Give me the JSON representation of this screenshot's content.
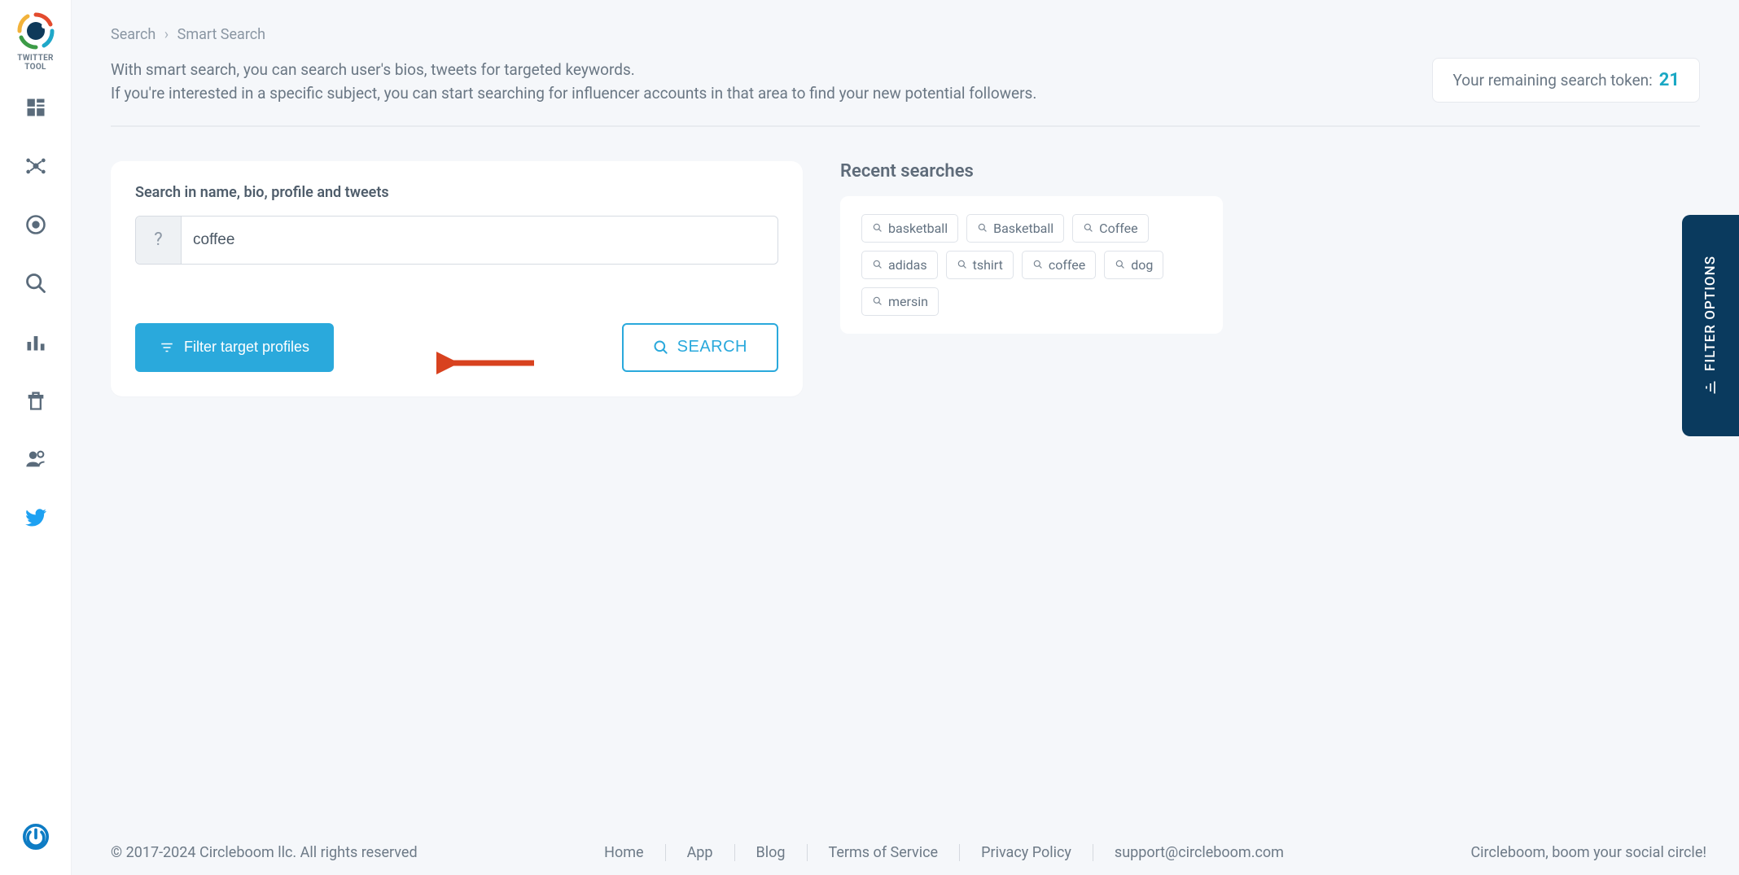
{
  "sidebar": {
    "logo_text": "TWITTER TOOL"
  },
  "breadcrumb": {
    "root": "Search",
    "current": "Smart Search"
  },
  "intro": {
    "line1": "With smart search, you can search user's bios, tweets for targeted keywords.",
    "line2": "If you're interested in a specific subject, you can start searching for influencer accounts in that area to find your new potential followers."
  },
  "token": {
    "label": "Your remaining search token:",
    "count": "21"
  },
  "search_card": {
    "heading": "Search in name, bio, profile and tweets",
    "help_glyph": "?",
    "input_value": "coffee",
    "filter_label": "Filter target profiles",
    "search_label": "SEARCH"
  },
  "recent": {
    "heading": "Recent searches",
    "items": [
      "basketball",
      "Basketball",
      "Coffee",
      "adidas",
      "tshirt",
      "coffee",
      "dog",
      "mersin"
    ]
  },
  "filter_tab": {
    "label": "FILTER OPTIONS"
  },
  "footer": {
    "copyright": "© 2017-2024 Circleboom llc. All rights reserved",
    "links": [
      "Home",
      "App",
      "Blog",
      "Terms of Service",
      "Privacy Policy",
      "support@circleboom.com"
    ],
    "tagline": "Circleboom, boom your social circle!"
  }
}
